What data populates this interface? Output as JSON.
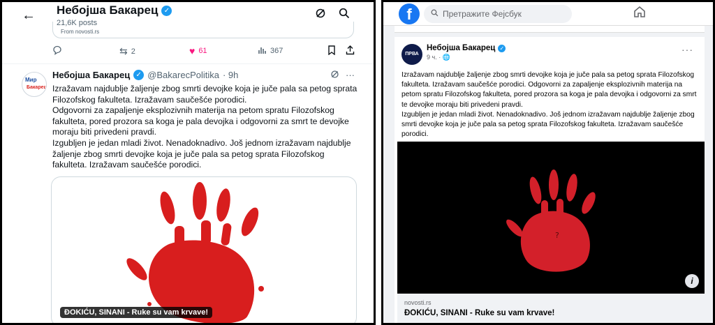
{
  "x_panel": {
    "profile_name": "Небојша Бакарец",
    "posts_count": "21,6K posts",
    "from_text": "From novosti.rs",
    "actions": {
      "replies": "",
      "reposts": "2",
      "likes": "61",
      "views": "367"
    },
    "post": {
      "author": "Небојша Бакарец",
      "handle": "@BakarecPolitika",
      "time": "· 9h",
      "avatar_line1": "Мир",
      "avatar_line2": "Бакарец",
      "text": "Izražavam najdublje žaljenje zbog smrti devojke koja je juče pala sa petog sprata Filozofskog fakulteta. Izražavam saučešće porodici.\nOdgovorni za zapaljenje eksplozivnih materija na petom spratu Filozofskog fakulteta, pored prozora sa koga je pala devojka i odgovorni za smrt te devojke moraju biti privedeni pravdi.\nIzgubljen je jedan mladi život. Nenadoknadivo. Još jednom izražavam najdublje žaljenje zbog smrti devojke koja je juče pala sa petog sprata Filozofskog fakulteta. Izražavam saučešće porodici.",
      "card_caption": "ĐOKIĆU, SINANI - Ruke su vam krvave!"
    },
    "icons": {
      "back": "arrow-left-icon",
      "rewind": "grok-icon",
      "search": "search-icon",
      "reply": "comment-icon",
      "repost": "repost-icon",
      "like": "heart-icon",
      "views": "bar-chart-icon",
      "bookmark": "bookmark-icon",
      "share": "share-icon"
    },
    "colors": {
      "like": "#f91880",
      "verified": "#1d9bf0",
      "hand": "#d81e1e"
    }
  },
  "fb_panel": {
    "search_placeholder": "Претражите Фејсбук",
    "post": {
      "author": "Небојша Бакарец",
      "avatar_text": "ПРВА",
      "meta": "9 ч. · 🌐",
      "text": "Izražavam najdublje žaljenje zbog smrti devojke koja je juče pala sa petog sprata Filozofskog fakulteta. Izražavam saučešće porodici. Odgovorni za zapaljenje eksplozivnih materija na petom spratu Filozofskog fakulteta, pored prozora sa koga je pala devojka i odgovorni za smrt te devojke moraju biti privedeni pravdi.\nIzgubljen je jedan mladi život. Nenadoknadivo. Još jednom izražavam najdublje žaljenje zbog smrti devojke koja je juče pala sa petog sprata Filozofskog fakulteta. Izražavam saučešće porodici.",
      "link_domain": "novosti.rs",
      "link_title": "ĐOKIĆU, SINANI - Ruke su vam krvave!"
    },
    "icons": {
      "logo": "facebook-logo-icon",
      "search": "search-icon",
      "home": "home-icon",
      "more": "more-icon",
      "info": "info-icon"
    },
    "colors": {
      "brand": "#1877f2",
      "hand": "#d3202a"
    }
  }
}
